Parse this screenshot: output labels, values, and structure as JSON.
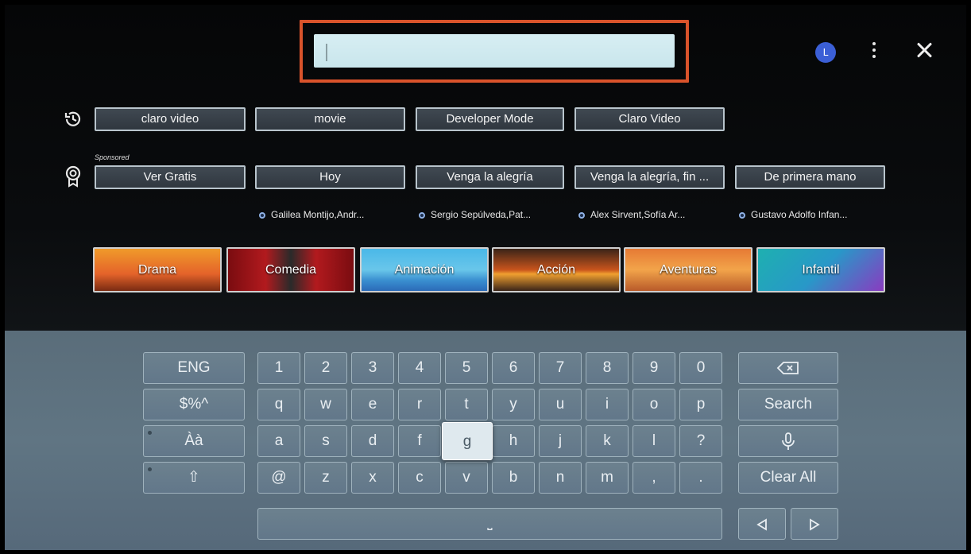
{
  "search": {
    "value": "",
    "placeholder": ""
  },
  "profile": {
    "avatar_letter": "L"
  },
  "recent_searches": [
    "claro video",
    "movie",
    "Developer Mode",
    "Claro Video"
  ],
  "sponsored": {
    "label": "Sponsored",
    "items": [
      "Ver Gratis",
      "Hoy",
      "Venga la alegría",
      "Venga la alegría, fin ...",
      "De primera mano"
    ]
  },
  "cast": [
    "Galilea Montijo,Andr...",
    "Sergio Sepúlveda,Pat...",
    "Alex Sirvent,Sofía Ar...",
    "Gustavo Adolfo Infan..."
  ],
  "genres": [
    "Drama",
    "Comedia",
    "Animación",
    "Acción",
    "Aventuras",
    "Infantil"
  ],
  "keyboard": {
    "left": [
      "ENG",
      "$%^",
      "Àà",
      "⇧"
    ],
    "row1": [
      "1",
      "2",
      "3",
      "4",
      "5",
      "6",
      "7",
      "8",
      "9",
      "0"
    ],
    "row2": [
      "q",
      "w",
      "e",
      "r",
      "t",
      "y",
      "u",
      "i",
      "o",
      "p"
    ],
    "row3": [
      "a",
      "s",
      "d",
      "f",
      "g",
      "h",
      "j",
      "k",
      "l",
      "?"
    ],
    "row4": [
      "@",
      "z",
      "x",
      "c",
      "v",
      "b",
      "n",
      "m",
      ",",
      "."
    ],
    "space": "⎵",
    "search_label": "Search",
    "clear_label": "Clear All",
    "focused_key": "g"
  },
  "icons": {
    "history": "history-icon",
    "sponsored": "award-icon",
    "more": "more-vertical-icon",
    "close": "close-icon",
    "backspace": "backspace-icon",
    "mic": "microphone-icon",
    "left": "arrow-left-icon",
    "right": "arrow-right-icon"
  },
  "colors": {
    "search_highlight": "#d9532b",
    "avatar": "#3b5fd6"
  }
}
